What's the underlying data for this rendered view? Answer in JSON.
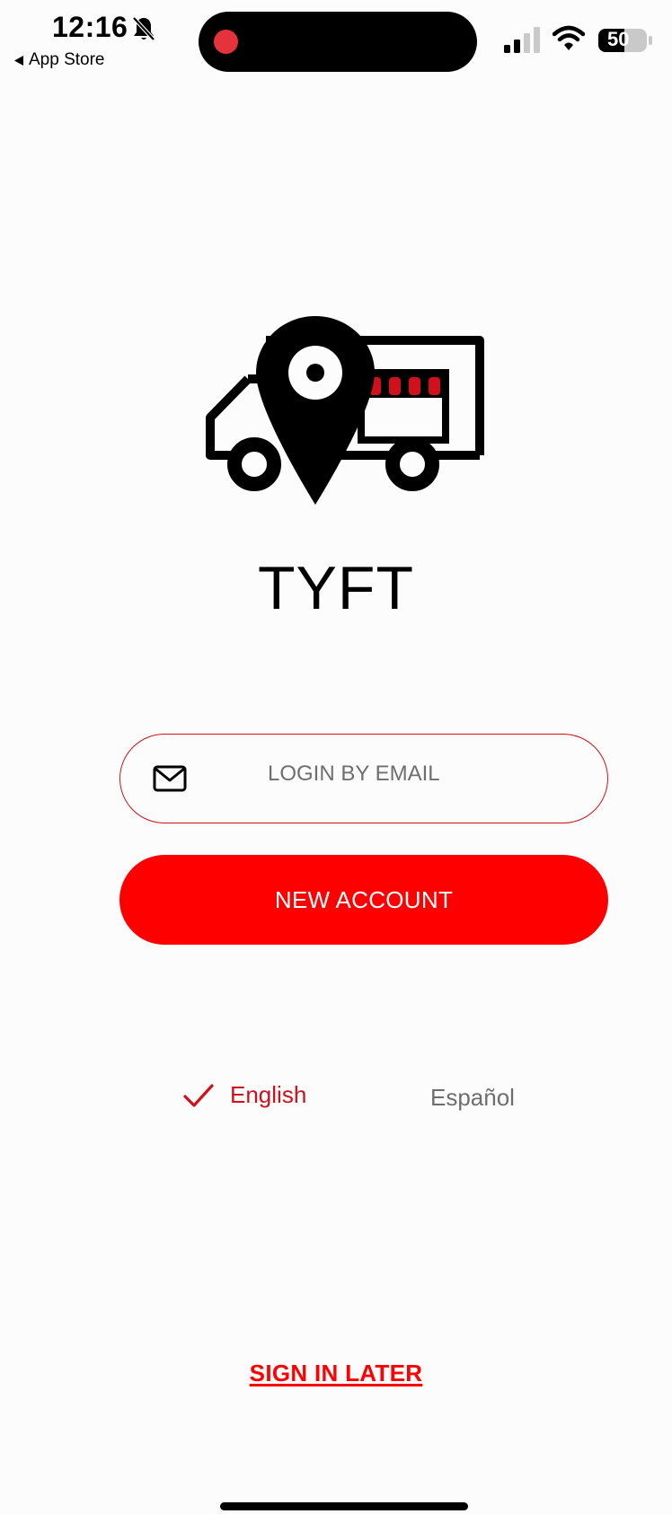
{
  "status_bar": {
    "time": "12:16",
    "back_label": "App Store",
    "battery": "50",
    "icons": [
      "bell-slash-icon",
      "back-arrow-icon",
      "signal-icon",
      "wifi-icon",
      "battery-icon"
    ]
  },
  "app": {
    "logo_icon": "food-truck-location-pin-logo",
    "name": "TYFT"
  },
  "actions": {
    "login_email_label": "LOGIN BY EMAIL",
    "login_email_icon": "mail-icon",
    "new_account_label": "NEW ACCOUNT",
    "sign_in_later_label": "SIGN IN LATER"
  },
  "languages": {
    "options": [
      {
        "label": "English",
        "selected": true
      },
      {
        "label": "Español",
        "selected": false
      }
    ],
    "selected_icon": "check-icon"
  },
  "colors": {
    "accent": "#ff0000",
    "accent_dark": "#d0111b",
    "muted_text": "#6e6e6e",
    "background": "#fdfcfd"
  }
}
